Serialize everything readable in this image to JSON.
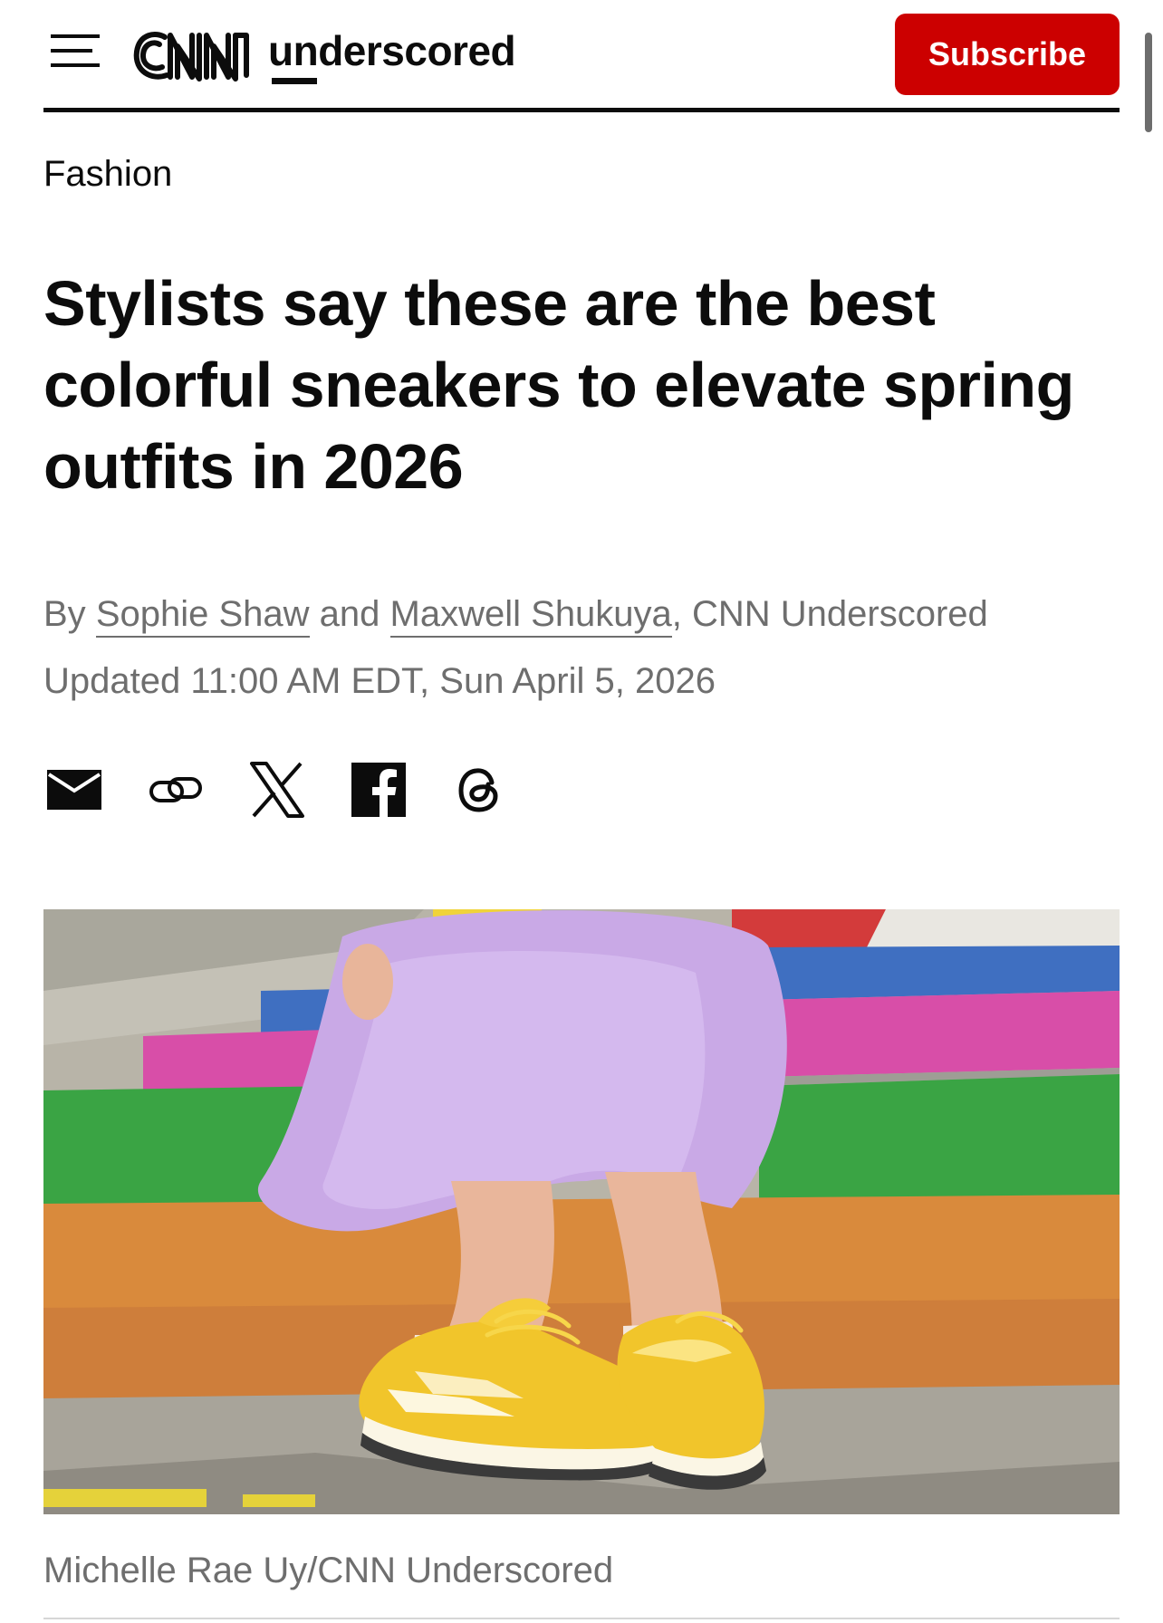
{
  "header": {
    "menu_icon": "hamburger-menu-icon",
    "logo_brand": "CNN",
    "logo_word": "underscored",
    "subscribe_label": "Subscribe",
    "subscribe_color": "#cc0000"
  },
  "article": {
    "section": "Fashion",
    "headline": "Stylists say these are the best colorful sneakers to elevate spring outfits in 2026",
    "byline": {
      "prefix": "By",
      "author1": "Sophie Shaw",
      "joiner": "and",
      "author2": "Maxwell Shukuya",
      "outlet": ", CNN Underscored"
    },
    "timestamp": "Updated 11:00 AM EDT, Sun April 5, 2026",
    "share_icons": [
      "email-icon",
      "copy-link-icon",
      "x-icon",
      "facebook-icon",
      "threads-icon"
    ],
    "hero_image": {
      "description_icon": "yellow-sneakers-photo",
      "caption": "Michelle Rae Uy/CNN Underscored"
    }
  },
  "colors": {
    "text": "#0c0c0c",
    "muted": "#6e6e6e",
    "accent": "#cc0000"
  }
}
